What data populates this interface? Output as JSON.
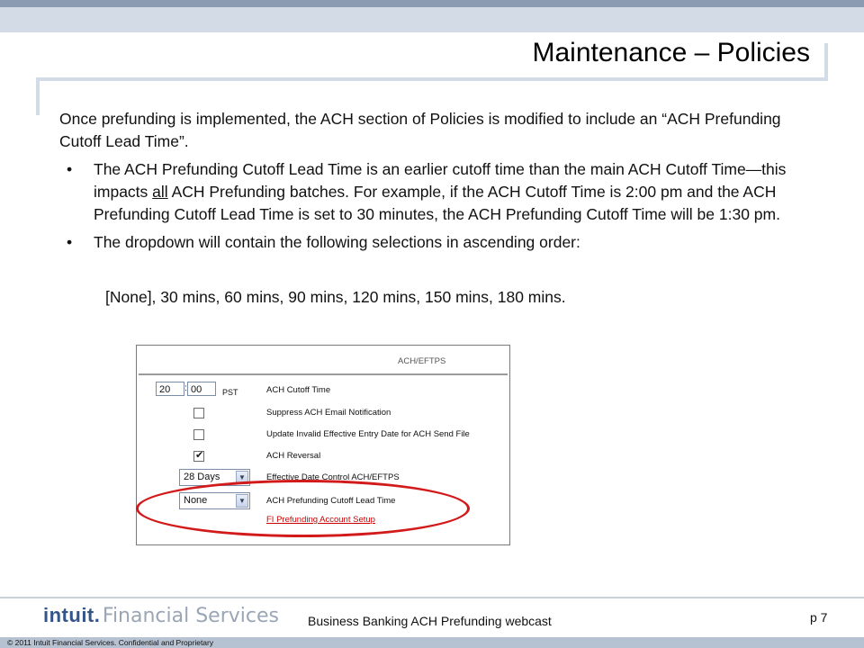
{
  "slide": {
    "title": "Maintenance – Policies",
    "intro": "Once prefunding is implemented, the ACH section of Policies is modified to include an “ACH Prefunding Cutoff Lead Time”.",
    "bullet1_part1": "The ACH Prefunding Cutoff Lead Time is an earlier cutoff time than the main ACH Cutoff Time—this impacts ",
    "bullet1_under": "all",
    "bullet1_part2": " ACH Prefunding batches. For example, if the ACH Cutoff Time is 2:00 pm and the ACH Prefunding Cutoff Lead Time is set to 30 minutes, the ACH Prefunding Cutoff Time will be 1:30 pm.",
    "bullet2": "The dropdown will contain the following selections in ascending order:",
    "selections": "[None], 30 mins, 60 mins, 90 mins, 120 mins, 150 mins, 180 mins."
  },
  "screenshot": {
    "header": "ACH/EFTPS",
    "cutoff_hours": "20",
    "cutoff_minutes": "00",
    "separator": ":",
    "timezone": "PST",
    "cutoff_label": "ACH Cutoff Time",
    "suppress_label": "Suppress ACH Email Notification",
    "suppress_checked": false,
    "update_label": "Update Invalid Effective Entry Date for ACH Send File",
    "update_checked": false,
    "reversal_label": "ACH Reversal",
    "reversal_checked": true,
    "effective_value": "28 Days",
    "effective_label": "Effective Date Control ACH/EFTPS",
    "prefund_value": "None",
    "prefund_label": "ACH Prefunding Cutoff Lead Time",
    "setup_link": "FI Prefunding Account Setup"
  },
  "footer": {
    "brand": "intuit",
    "brand_dot": ".",
    "brand_sub": "Financial Services",
    "webcast": "Business Banking ACH Prefunding webcast",
    "page": "p 7",
    "copyright": "© 2011 Intuit Financial Services. Confidential and Proprietary"
  },
  "colors": {
    "highlight": "#d21a1a",
    "brand": "#33558a"
  }
}
